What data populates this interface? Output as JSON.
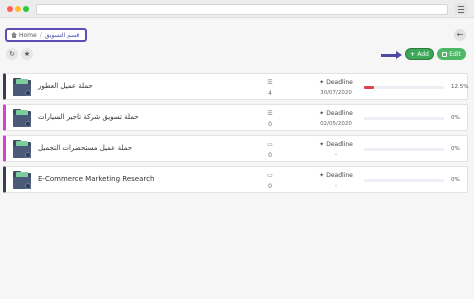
{
  "breadcrumb": {
    "home": "Home",
    "separator": "/",
    "current": "قسم التسويق"
  },
  "toolbar": {
    "add_label": "Add",
    "edit_label": "Edit",
    "refresh_icon": "refresh-icon",
    "star_icon": "star-icon",
    "back_icon": "arrow-left-icon"
  },
  "colors": {
    "add": "#3aa856",
    "edit": "#4cb866",
    "annotation": "#4d47a6",
    "progress": "#e0434f"
  },
  "projects": [
    {
      "title": "حملة عميل العطور",
      "accent": "#3a3f4d",
      "count_icon": "list-icon",
      "count": "4",
      "deadline_label": "Deadline",
      "deadline_date": "30/07/2020",
      "progress": 0.125,
      "progress_label": "12.5%"
    },
    {
      "title": "حملة تسويق شركة تاجير السيارات",
      "accent": "#d63fcf",
      "count_icon": "list-icon",
      "count": "0",
      "deadline_label": "Deadline",
      "deadline_date": "02/05/2020",
      "progress": 0,
      "progress_label": "0%"
    },
    {
      "title": "حملة عميل مستحضرات التجميل",
      "accent": "#d63fcf",
      "count_icon": "folder-icon",
      "count": "0",
      "deadline_label": "Deadline",
      "deadline_date": "-",
      "progress": 0,
      "progress_label": "0%"
    },
    {
      "title": "E-Commerce Marketing Research",
      "accent": "#3a3f4d",
      "count_icon": "folder-icon",
      "count": "0",
      "deadline_label": "Deadline",
      "deadline_date": "-",
      "progress": 0,
      "progress_label": "0%"
    }
  ]
}
